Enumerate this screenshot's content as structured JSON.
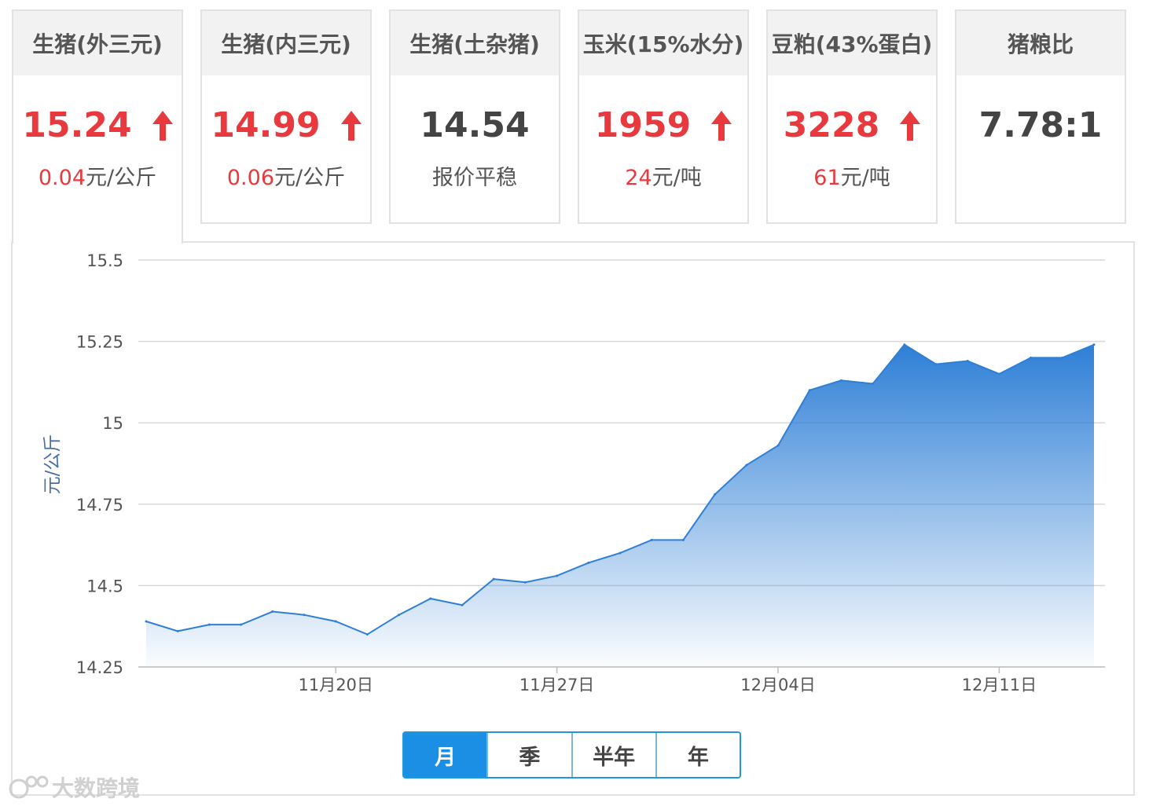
{
  "tabs": [
    {
      "name": "生猪(外三元)",
      "price": "15.24",
      "trend": "up",
      "change": "0.04",
      "unit": "元/公斤",
      "active": true
    },
    {
      "name": "生猪(内三元)",
      "price": "14.99",
      "trend": "up",
      "change": "0.06",
      "unit": "元/公斤",
      "active": false
    },
    {
      "name": "生猪(土杂猪)",
      "price": "14.54",
      "trend": "flat",
      "change": "",
      "unit": "报价平稳",
      "active": false
    },
    {
      "name": "玉米(15%水分)",
      "price": "1959",
      "trend": "up",
      "change": "24",
      "unit": "元/吨",
      "active": false
    },
    {
      "name": "豆粕(43%蛋白)",
      "price": "3228",
      "trend": "up",
      "change": "61",
      "unit": "元/吨",
      "active": false
    },
    {
      "name": "猪粮比",
      "price": "7.78:1",
      "trend": "none",
      "change": "",
      "unit": "",
      "active": false
    }
  ],
  "range_buttons": [
    {
      "label": "月",
      "active": true
    },
    {
      "label": "季",
      "active": false
    },
    {
      "label": "半年",
      "active": false
    },
    {
      "label": "年",
      "active": false
    }
  ],
  "watermark": "大数跨境",
  "colors": {
    "up": "#e8393e",
    "line": "#2e7fd6",
    "active_button": "#1a8fe3"
  },
  "chart_data": {
    "type": "area",
    "title": "",
    "xlabel": "",
    "ylabel": "元/公斤",
    "ylim": [
      14.25,
      15.5
    ],
    "yticks": [
      14.25,
      14.5,
      14.75,
      15,
      15.25,
      15.5
    ],
    "ytick_labels": [
      "14.25",
      "14.5",
      "14.75",
      "15",
      "15.25",
      "15.5"
    ],
    "xtick_labels": [
      {
        "label": "11月20日",
        "index": 6
      },
      {
        "label": "11月27日",
        "index": 13
      },
      {
        "label": "12月04日",
        "index": 20
      },
      {
        "label": "12月11日",
        "index": 27
      }
    ],
    "grid": true,
    "series": [
      {
        "values": [
          14.39,
          14.36,
          14.38,
          14.38,
          14.42,
          14.41,
          14.39,
          14.35,
          14.41,
          14.46,
          14.44,
          14.52,
          14.51,
          14.53,
          14.57,
          14.6,
          14.64,
          14.64,
          14.78,
          14.87,
          14.93,
          15.1,
          15.13,
          15.12,
          15.24,
          15.18,
          15.19,
          15.15,
          15.2,
          15.2,
          15.24
        ]
      }
    ]
  }
}
